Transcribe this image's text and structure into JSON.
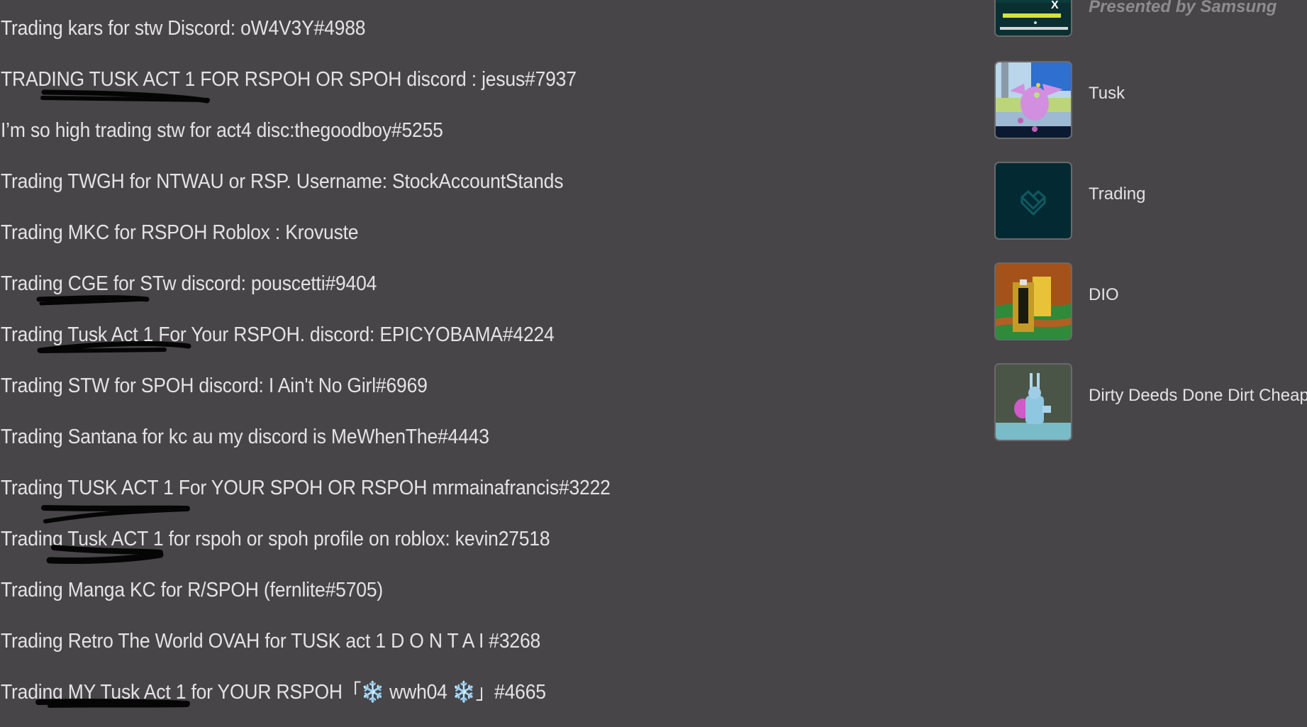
{
  "background_color": "#474547",
  "text_color": "#e4e2e4",
  "posts": [
    {
      "text": "Trading kars for stw Discord: oW4V3Y#4988"
    },
    {
      "text": "TRADING TUSK ACT 1 FOR RSPOH OR SPOH discord : jesus#7937"
    },
    {
      "text": "I’m so high trading stw for act4 disc:thegoodboy#5255"
    },
    {
      "text": "Trading TWGH for NTWAU or RSP. Username: StockAccountStands"
    },
    {
      "text": "Trading MKC for RSPOH Roblox : Krovuste"
    },
    {
      "text": "Trading CGE for STw discord: pouscetti#9404"
    },
    {
      "text": "Trading Tusk Act 1 For Your RSPOH. discord: EPICYOBAMA#4224"
    },
    {
      "text": "Trading STW for SPOH discord: I Ain't No Girl#6969"
    },
    {
      "text": "Trading Santana for kc au my discord is MeWhenThe#4443"
    },
    {
      "text": "Trading TUSK ACT 1 For YOUR SPOH OR RSPOH mrmainafrancis#3222"
    },
    {
      "text": "Trading Tusk ACT 1 for rspoh or spoh profile on roblox: kevin27518"
    },
    {
      "text": "Trading Manga KC for R/SPOH (fernlite#5705)"
    },
    {
      "text": "Trading Retro The World OVAH for TUSK act 1 D O N T A I #3268"
    },
    {
      "text": "Trading MY Tusk Act 1 for YOUR RSPOH「❄️ wwh04 ❄️」#4665"
    }
  ],
  "sidebar": {
    "presented_by": "Presented by Samsung",
    "items": [
      {
        "label": "Tusk",
        "thumb": "tusk-stand-thumbnail"
      },
      {
        "label": "Trading",
        "thumb": "trading-heart-thumbnail"
      },
      {
        "label": "DIO",
        "thumb": "dio-thumbnail"
      },
      {
        "label": "Dirty Deeds Done Dirt Cheap",
        "thumb": "d4c-thumbnail"
      }
    ]
  }
}
